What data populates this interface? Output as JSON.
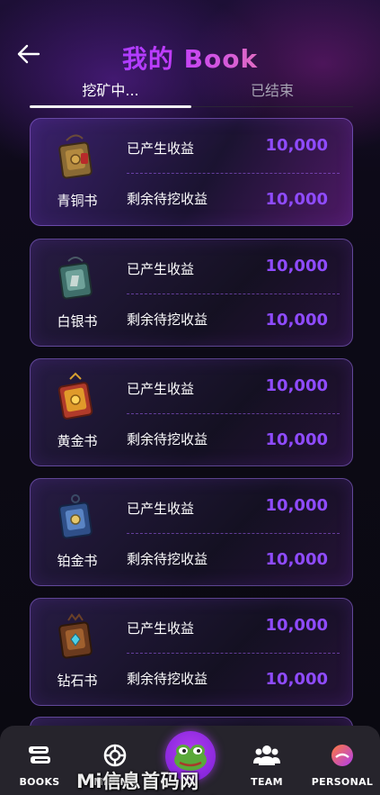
{
  "header": {
    "title": "我的 Book"
  },
  "tabs": [
    {
      "label": "挖矿中...",
      "active": true
    },
    {
      "label": "已结束",
      "active": false
    }
  ],
  "cards": [
    {
      "book": "青铜书",
      "icon": "bronze-book-icon",
      "earned_label": "已产生收益",
      "earned_value": "10,000",
      "remaining_label": "剩余待挖收益",
      "remaining_value": "10,000"
    },
    {
      "book": "白银书",
      "icon": "silver-book-icon",
      "earned_label": "已产生收益",
      "earned_value": "10,000",
      "remaining_label": "剩余待挖收益",
      "remaining_value": "10,000"
    },
    {
      "book": "黄金书",
      "icon": "gold-book-icon",
      "earned_label": "已产生收益",
      "earned_value": "10,000",
      "remaining_label": "剩余待挖收益",
      "remaining_value": "10,000"
    },
    {
      "book": "铂金书",
      "icon": "platinum-book-icon",
      "earned_label": "已产生收益",
      "earned_value": "10,000",
      "remaining_label": "剩余待挖收益",
      "remaining_value": "10,000"
    },
    {
      "book": "钻石书",
      "icon": "diamond-book-icon",
      "earned_label": "已产生收益",
      "earned_value": "10,000",
      "remaining_label": "剩余待挖收益",
      "remaining_value": "10,000"
    }
  ],
  "nav": [
    {
      "label": "BOOKS",
      "icon": "books-icon"
    },
    {
      "label": "MINING",
      "icon": "mining-icon"
    },
    {
      "label": "",
      "icon": "frog-avatar-icon"
    },
    {
      "label": "TEAM",
      "icon": "team-icon"
    },
    {
      "label": "PERSONAL",
      "icon": "personal-icon"
    }
  ],
  "watermark": "Mi信息首码网 www.mixinxi.com",
  "colors": {
    "accent_purple": "#8f4bff",
    "card_border": "#966ee6",
    "nav_bg": "#26242c",
    "center_button": "#b03cf0"
  }
}
